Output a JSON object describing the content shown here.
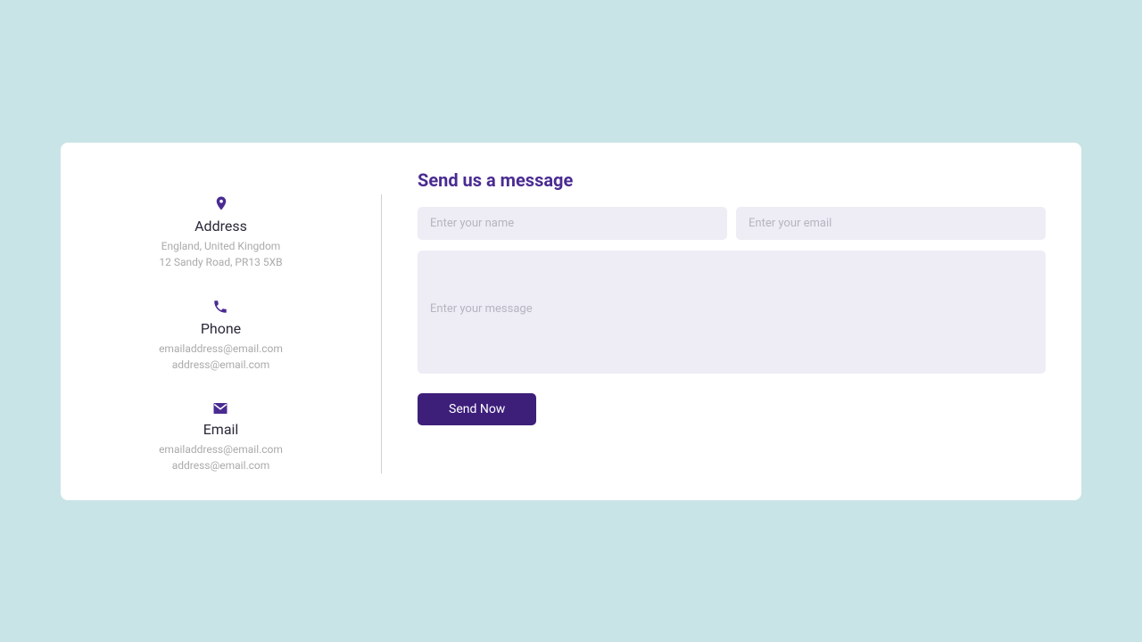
{
  "contact": {
    "address": {
      "title": "Address",
      "line1": "England, United Kingdom",
      "line2": "12 Sandy Road, PR13 5XB"
    },
    "phone": {
      "title": "Phone",
      "line1": "emailaddress@email.com",
      "line2": "address@email.com"
    },
    "email": {
      "title": "Email",
      "line1": "emailaddress@email.com",
      "line2": "address@email.com"
    }
  },
  "form": {
    "title": "Send us a message",
    "name_placeholder": "Enter your name",
    "email_placeholder": "Enter your email",
    "message_placeholder": "Enter your message",
    "submit_label": "Send Now"
  }
}
